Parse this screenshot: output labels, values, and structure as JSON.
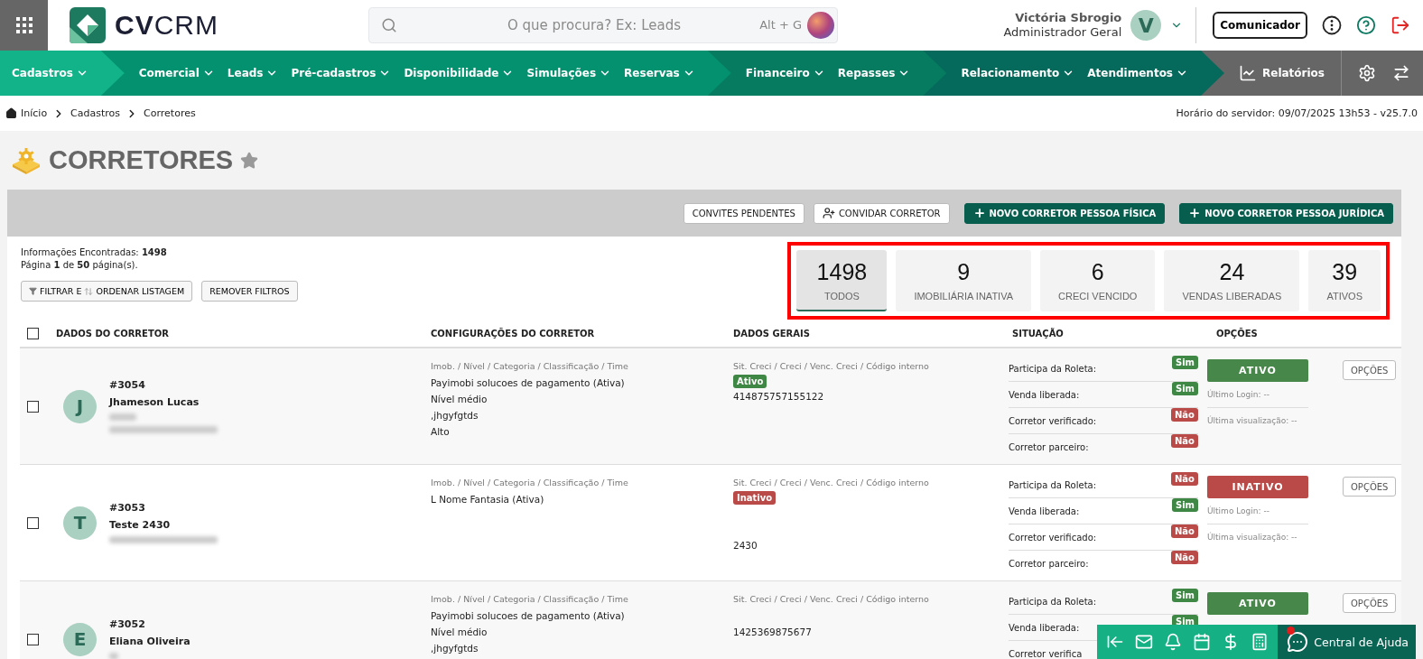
{
  "header": {
    "logo": {
      "bold": "CV",
      "light": "CRM"
    },
    "search_placeholder": "O que procura? Ex: Leads",
    "shortcut": "Alt + G",
    "user": {
      "name": "Victória Sbrogio",
      "role": "Administrador Geral",
      "initial": "V"
    },
    "communicator": "Comunicador"
  },
  "nav": {
    "groups": [
      {
        "color": "#12b388",
        "items": [
          "Cadastros"
        ]
      },
      {
        "color": "#04916f",
        "items": [
          "Comercial",
          "Leads",
          "Pré-cadastros",
          "Disponibilidade",
          "Simulações",
          "Reservas"
        ]
      },
      {
        "color": "#067b60",
        "items": [
          "Financeiro",
          "Repasses"
        ]
      },
      {
        "color": "#056a5b",
        "items": [
          "Relacionamento",
          "Atendimentos"
        ]
      }
    ],
    "reports": "Relatórios"
  },
  "breadcrumb": [
    "Início",
    "Cadastros",
    "Corretores"
  ],
  "server_time": "Horário do servidor: 09/07/2025 13h53 - v25.7.0",
  "page": {
    "title": "CORRETORES",
    "favorite": false
  },
  "toolbar": [
    {
      "label": "CONVITES PENDENTES",
      "kind": "plain"
    },
    {
      "label": "CONVIDAR CORRETOR",
      "kind": "invite"
    },
    {
      "label": "NOVO CORRETOR PESSOA FÍSICA",
      "kind": "primary"
    },
    {
      "label": "NOVO CORRETOR PESSOA JURÍDICA",
      "kind": "primary"
    }
  ],
  "info": [
    "Informações Encontradas: **1498**",
    "Página **1** de **50** página(s)."
  ],
  "filters": [
    {
      "kind": "filter",
      "before": "FILTRAR E",
      "after": "ORDENAR LISTAGEM"
    },
    {
      "kind": "plain",
      "before": "REMOVER FILTROS"
    }
  ],
  "stats": [
    {
      "value": "1498",
      "label": "TODOS",
      "selected": true
    },
    {
      "value": "9",
      "label": "IMOBILIÁRIA INATIVA",
      "selected": false
    },
    {
      "value": "6",
      "label": "CRECI VENCIDO",
      "selected": false
    },
    {
      "value": "24",
      "label": "VENDAS LIBERADAS",
      "selected": false
    },
    {
      "value": "39",
      "label": "ATIVOS",
      "selected": false
    }
  ],
  "select_all": {
    "checked": false
  },
  "columns": [
    "DADOS DO CORRETOR",
    "CONFIGURAÇÕES DO CORRETOR",
    "DADOS GERAIS",
    "SITUAÇÃO",
    "OPÇÕES"
  ],
  "rows": [
    {
      "checked": false,
      "id": "#3054",
      "name": "Jhameson Lucas",
      "initial": "J",
      "redacted": [
        {
          "kind": "short"
        },
        {
          "kind": "long"
        }
      ],
      "config_caption": "Imob. / Nível / Categoria / Classificação / Time",
      "config": [
        "Payimobi solucoes de pagamento (Ativa)",
        "Nível médio",
        ",jhgyfgtds",
        "Alto"
      ],
      "creci_caption": "Sit. Creci / Creci / Venc. Creci / Código interno",
      "creci": [
        {
          "kind": "badge",
          "text": "Ativo",
          "on": true
        },
        {
          "kind": "text",
          "text": "414875757155122"
        }
      ],
      "flags": [
        {
          "label": "Participa da Roleta:",
          "value": "Sim",
          "on": true
        },
        {
          "label": "Venda liberada:",
          "value": "Sim",
          "on": true
        },
        {
          "label": "Corretor verificado:",
          "value": "Não",
          "on": false
        },
        {
          "label": "Corretor parceiro:",
          "value": "Não",
          "on": false
        }
      ],
      "status": {
        "label": "ATIVO",
        "active": true
      },
      "last_login": "Último Login: --",
      "last_view": "Última visualização: --",
      "options": "OPÇÕES"
    },
    {
      "checked": false,
      "id": "#3053",
      "name": "Teste 2430",
      "initial": "T",
      "redacted": [
        {
          "kind": "long"
        }
      ],
      "config_caption": "Imob. / Nível / Categoria / Classificação / Time",
      "config": [
        "L Nome Fantasia (Ativa)"
      ],
      "creci_caption": "Sit. Creci / Creci / Venc. Creci / Código interno",
      "creci": [
        {
          "kind": "badge",
          "text": "Inativo",
          "on": false
        },
        {
          "kind": "gap"
        },
        {
          "kind": "gap"
        },
        {
          "kind": "text",
          "text": "2430"
        }
      ],
      "flags": [
        {
          "label": "Participa da Roleta:",
          "value": "Não",
          "on": false
        },
        {
          "label": "Venda liberada:",
          "value": "Sim",
          "on": true
        },
        {
          "label": "Corretor verificado:",
          "value": "Não",
          "on": false
        },
        {
          "label": "Corretor parceiro:",
          "value": "Não",
          "on": false
        }
      ],
      "status": {
        "label": "INATIVO",
        "active": false
      },
      "last_login": "Último Login: --",
      "last_view": "Última visualização: --",
      "options": "OPÇÕES"
    },
    {
      "checked": false,
      "id": "#3052",
      "name": "Eliana Oliveira",
      "initial": "E",
      "redacted": [
        {
          "kind": "tiny"
        }
      ],
      "config_caption": "Imob. / Nível / Categoria / Classificação / Time",
      "config": [
        "Payimobi solucoes de pagamento (Ativa)",
        "Nível médio",
        ",jhgyfgtds"
      ],
      "creci_caption": "Sit. Creci / Creci / Venc. Creci / Código interno",
      "creci": [
        {
          "kind": "gap"
        },
        {
          "kind": "text",
          "text": "1425369875677"
        }
      ],
      "flags": [
        {
          "label": "Participa da Roleta:",
          "value": "Sim",
          "on": true
        },
        {
          "label": "Venda liberada:",
          "value": "Sim",
          "on": true
        },
        {
          "label": "Corretor verifica"
        }
      ],
      "status": {
        "label": "ATIVO",
        "active": true
      },
      "options": "OPÇÕES"
    }
  ],
  "dock": {
    "help_label": "Central de Ajuda",
    "notification": true
  }
}
